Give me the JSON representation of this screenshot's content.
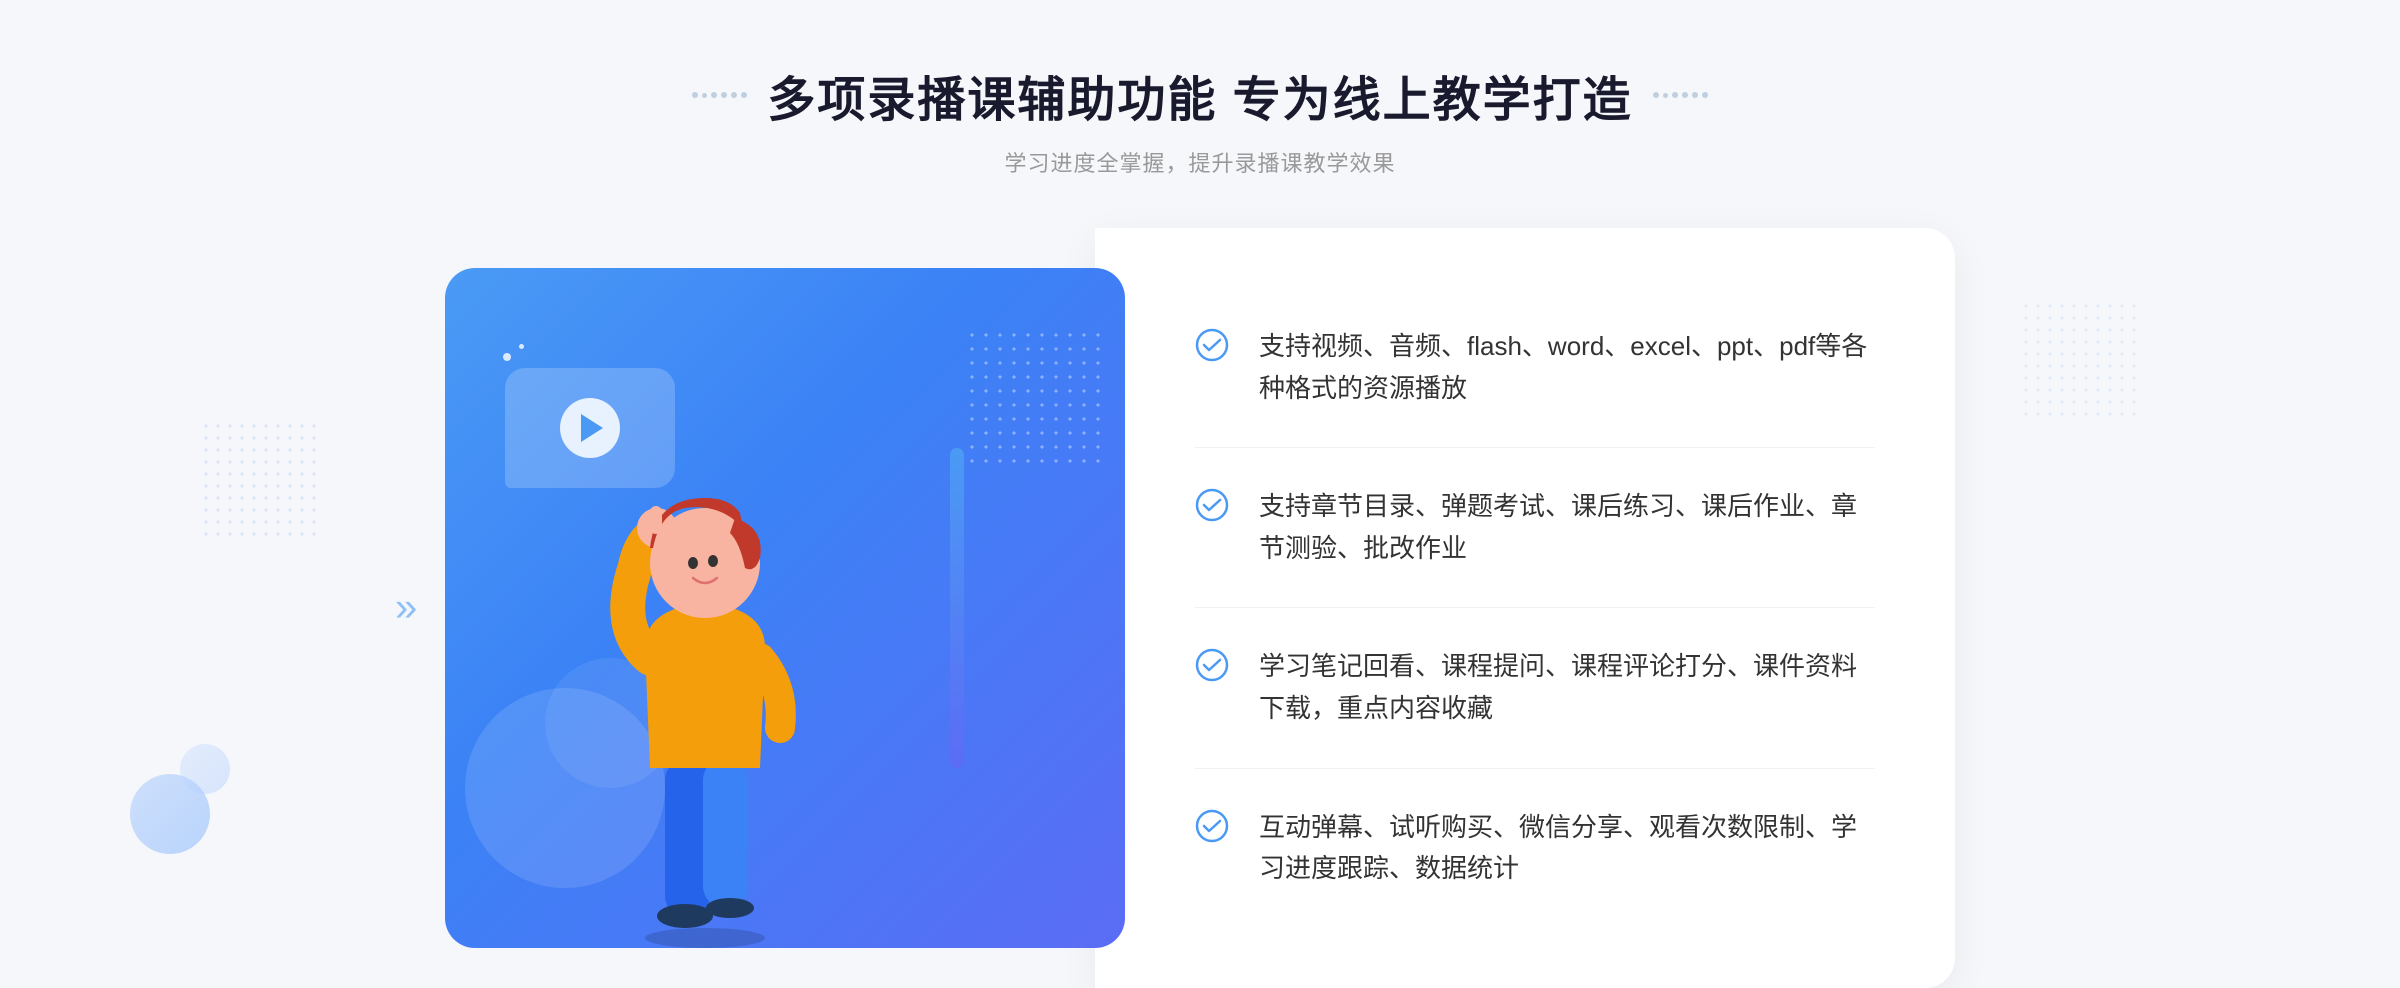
{
  "header": {
    "title": "多项录播课辅助功能 专为线上教学打造",
    "subtitle": "学习进度全掌握，提升录播课教学效果",
    "decorator_left": "decorative-dots-left",
    "decorator_right": "decorative-dots-right"
  },
  "features": [
    {
      "id": 1,
      "text": "支持视频、音频、flash、word、excel、ppt、pdf等各种格式的资源播放"
    },
    {
      "id": 2,
      "text": "支持章节目录、弹题考试、课后练习、课后作业、章节测验、批改作业"
    },
    {
      "id": 3,
      "text": "学习笔记回看、课程提问、课程评论打分、课件资料下载，重点内容收藏"
    },
    {
      "id": 4,
      "text": "互动弹幕、试听购买、微信分享、观看次数限制、学习进度跟踪、数据统计"
    }
  ],
  "colors": {
    "primary_blue": "#4a9af5",
    "gradient_end": "#5b6cf5",
    "text_dark": "#1a1a2e",
    "text_gray": "#999999",
    "text_body": "#333333",
    "check_color": "#4a9af5"
  }
}
